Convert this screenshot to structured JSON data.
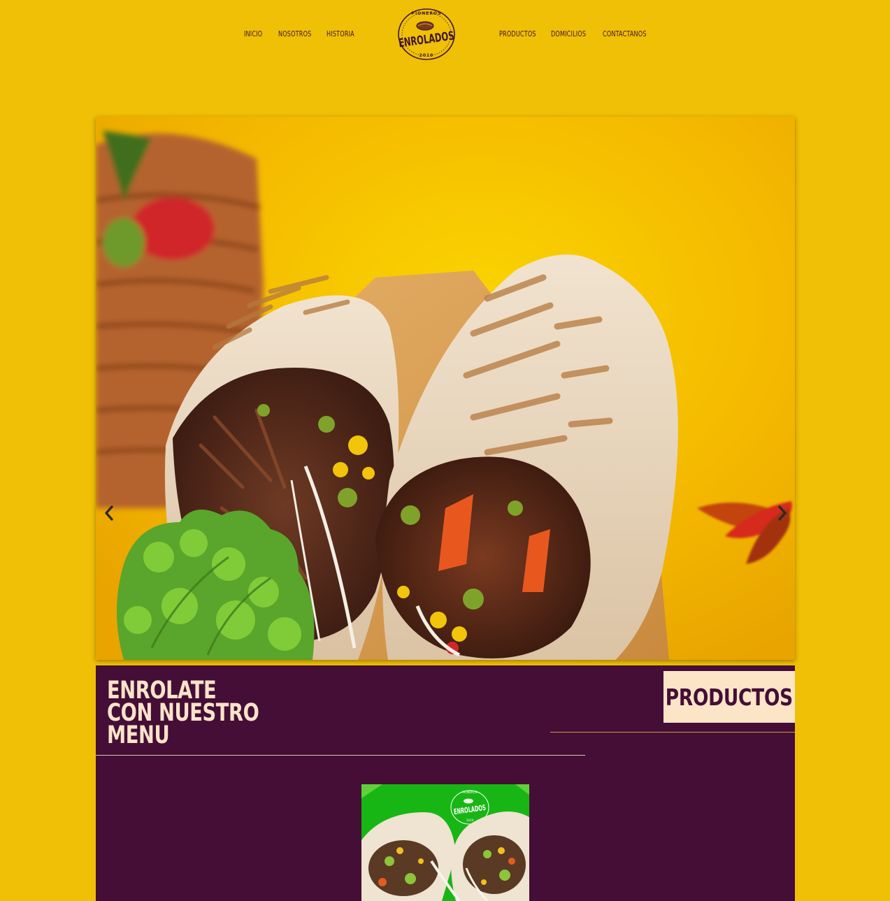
{
  "nav": {
    "left_items": [
      {
        "label": "INICIO"
      },
      {
        "label": "NOSOTROS"
      },
      {
        "label": "HISTORIA"
      }
    ],
    "right_items": [
      {
        "label": "PRODUCTOS"
      },
      {
        "label": "DOMICILIOS"
      },
      {
        "label": "CONTACTANOS"
      }
    ],
    "logo": {
      "brand": "ENROLADOS",
      "top_text": "PIONEROS",
      "year": "2019"
    }
  },
  "hero": {
    "image_icon": "burrito-photo",
    "prev_icon": "chevron-left-icon",
    "next_icon": "chevron-right-icon"
  },
  "menu": {
    "title_lines": [
      "ENROLATE",
      "CON NUESTRO",
      "MENU"
    ],
    "button_label": "PRODUCTOS",
    "card": {
      "brand": "ENROLADOS",
      "top_text": "PIONEROS",
      "year": "2019"
    }
  },
  "colors": {
    "background": "#efc005",
    "nav_text": "#3e1431",
    "section_bg": "#440e36",
    "title_text": "#fbe4c9",
    "button_bg": "#fce5c7"
  }
}
